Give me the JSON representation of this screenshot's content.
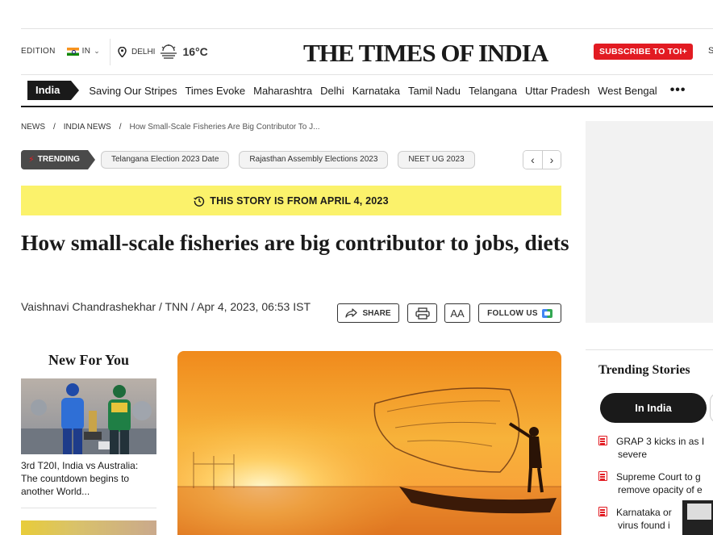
{
  "header": {
    "edition_label": "EDITION",
    "edition_value": "IN",
    "city": "DELHI",
    "temperature": "16°C",
    "logo": "THE TIMES OF INDIA",
    "subscribe": "SUBSCRIBE TO TOI+",
    "cut_text": "S"
  },
  "nav": {
    "active": "India",
    "items": [
      "Saving Our Stripes",
      "Times Evoke",
      "Maharashtra",
      "Delhi",
      "Karnataka",
      "Tamil Nadu",
      "Telangana",
      "Uttar Pradesh",
      "West Bengal"
    ],
    "more": "•••"
  },
  "breadcrumb": [
    "NEWS",
    "INDIA NEWS",
    "How Small-Scale Fisheries Are Big Contributor To J..."
  ],
  "trending": {
    "label": "TRENDING",
    "chips": [
      "Telangana Election 2023 Date",
      "Rajasthan Assembly Elections 2023",
      "NEET UG 2023"
    ]
  },
  "banner": "THIS STORY IS FROM APRIL 4, 2023",
  "article": {
    "headline": "How small-scale fisheries are big contributor to jobs, diets",
    "byline": "Vaishnavi Chandrashekhar / TNN / Apr 4, 2023, 06:53 IST",
    "share": "SHARE",
    "font_size": "AA",
    "follow": "FOLLOW US"
  },
  "new_for_you": {
    "title": "New For You",
    "items": [
      {
        "text": "3rd T20I, India vs Australia: The countdown begins to another World..."
      }
    ]
  },
  "trending_stories": {
    "title": "Trending Stories",
    "tab": "In India",
    "items": [
      {
        "line1": "GRAP 3 kicks in as I",
        "line2": "severe"
      },
      {
        "line1": "Supreme Court to g",
        "line2": "remove opacity of e"
      },
      {
        "line1": "Karnataka or",
        "line2": "virus found i"
      }
    ]
  },
  "colors": {
    "accent_red": "#e21b22",
    "banner_yellow": "#fbf26b",
    "dark": "#1a1a1a"
  }
}
